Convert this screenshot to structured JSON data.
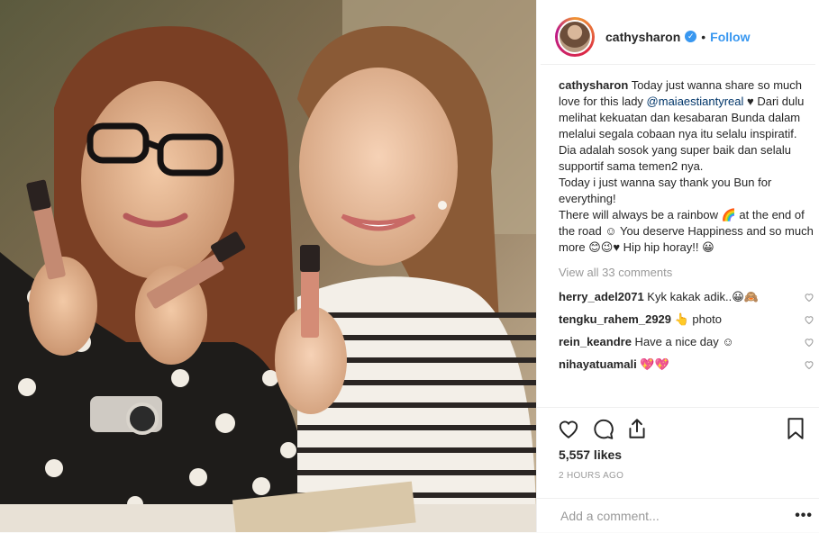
{
  "post": {
    "username": "cathysharon",
    "verified_glyph": "✓",
    "separator": "•",
    "follow_label": "Follow",
    "caption": {
      "username": "cathysharon",
      "text_before": " Today just wanna share so much love for this lady ",
      "mention": "@maiaestiantyreal",
      "text_after": " ♥ Dari dulu melihat kekuatan dan kesabaran Bunda dalam melalui segala cobaan nya itu selalu inspiratif. Dia adalah sosok yang super baik dan selalu supportif sama temen2 nya.",
      "line2": "Today i just wanna say thank you Bun for everything!",
      "line3": "There will always be a rainbow 🌈 at the end of the road ☺ You deserve Happiness and so much more 😊😉♥ Hip hip horay!! 😀"
    },
    "view_all": "View all 33 comments",
    "comments": [
      {
        "user": "herry_adel2071",
        "text": " Kyk kakak adik..😀🙈"
      },
      {
        "user": "tengku_rahem_2929",
        "text": " 👆 photo"
      },
      {
        "user": "rein_keandre",
        "text": " Have a nice day ☺"
      },
      {
        "user": "nihayatuamali",
        "text": " 💖💖"
      }
    ],
    "likes": "5,557 likes",
    "timestamp": "2 HOURS AGO",
    "comment_placeholder": "Add a comment...",
    "more_glyph": "•••",
    "icons": {
      "like": "heart-icon",
      "comment": "comment-icon",
      "share": "share-icon",
      "save": "bookmark-icon"
    }
  }
}
